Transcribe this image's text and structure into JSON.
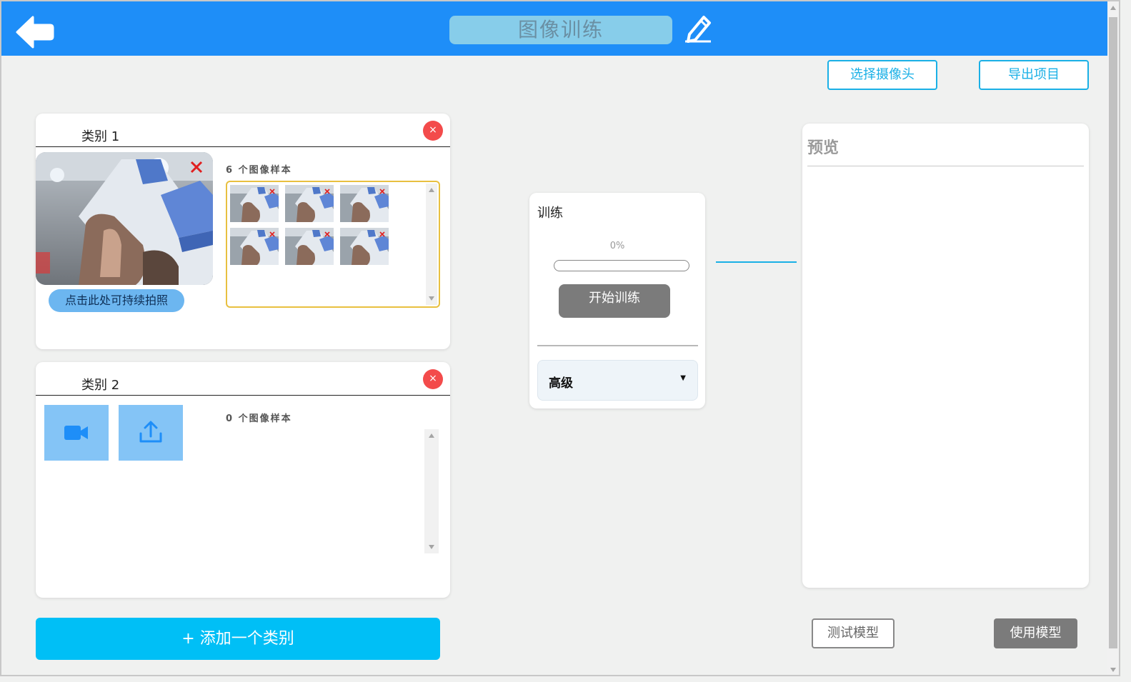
{
  "header": {
    "title": "图像训练",
    "colors": {
      "bar": "#1e8ef8",
      "title_box": "#87cdea"
    }
  },
  "toolbar": {
    "select_camera": "选择摄像头",
    "export_project": "导出项目"
  },
  "classes": [
    {
      "name": "类别 1",
      "sample_count_text": "6 个图像样本",
      "sample_count": 6,
      "capture_button": "点击此处可持续拍照",
      "close_symbol": "×"
    },
    {
      "name": "类别 2",
      "sample_count_text": "0 个图像样本",
      "sample_count": 0,
      "close_symbol": "×",
      "actions": [
        "webcam-icon",
        "upload-icon"
      ]
    }
  ],
  "add_class_button": "+ 添加一个类别",
  "training": {
    "title": "训练",
    "progress_text": "0%",
    "progress": 0,
    "start_button": "开始训练",
    "advanced_label": "高级",
    "advanced_caret": "▼"
  },
  "preview": {
    "title": "预览"
  },
  "bottom_buttons": {
    "test_model": "测试模型",
    "use_model": "使用模型"
  },
  "icons": {
    "back": "back-arrow-icon",
    "edit": "pencil-icon",
    "camera": "video-camera-icon",
    "upload": "upload-icon"
  },
  "accent_colors": {
    "primary": "#1e8ef8",
    "cyan": "#00bff6",
    "outline": "#1ab0e6",
    "danger": "#f34b4b",
    "highlight_border": "#e8c040"
  }
}
